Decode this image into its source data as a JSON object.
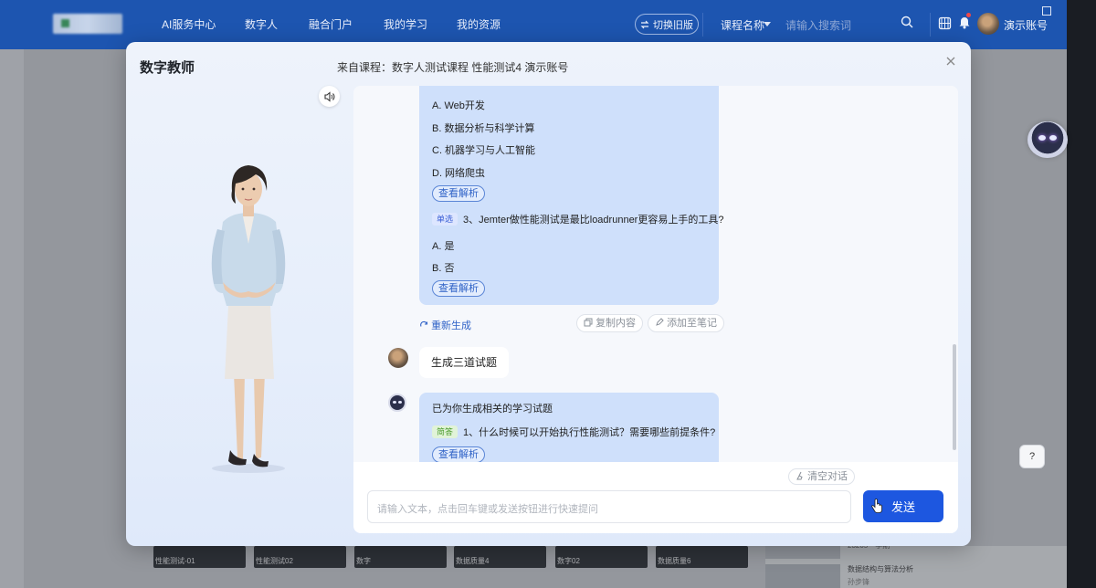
{
  "header": {
    "nav": [
      "AI服务中心",
      "数字人",
      "融合门户",
      "我的学习",
      "我的资源"
    ],
    "switch_label": "切换旧版",
    "course_select": "课程名称",
    "search_placeholder": "请输入搜索词",
    "username": "演示账号"
  },
  "background": {
    "thumbs": [
      "性能测试-01",
      "性能测试02",
      "数字",
      "数据质量4",
      "数字02",
      "数据质量6"
    ],
    "side_list": {
      "code": "23205一学期",
      "title": "数据结构与算法分析",
      "author": "孙步锋"
    }
  },
  "modal": {
    "title": "数字教师",
    "source": "来自课程：数字人测试课程 性能测试4 演示账号"
  },
  "chat": {
    "bubble1": {
      "options_q2": [
        "A. Web开发",
        "B. 数据分析与科学计算",
        "C. 机器学习与人工智能",
        "D. 网络爬虫"
      ],
      "view_analysis": "查看解析",
      "q3_tag": "单选",
      "q3_text": "3、Jemter做性能测试是最比loadrunner更容易上手的工具?",
      "options_q3": [
        "A. 是",
        "B. 否"
      ]
    },
    "actions": {
      "regen": "重新生成",
      "copy": "复制内容",
      "add_note": "添加至笔记"
    },
    "user_message": "生成三道试题",
    "bubble2": {
      "intro": "已为你生成相关的学习试题",
      "q1_tag": "简答",
      "q1_text": "1、什么时候可以开始执行性能测试？需要哪些前提条件?",
      "view_analysis": "查看解析"
    },
    "clear_label": "清空对话",
    "input_placeholder": "请输入文本，点击回车键或发送按钮进行快速提问",
    "send_label": "发送"
  },
  "float": {
    "help_label": "?"
  },
  "colors": {
    "brand": "#1d55b0",
    "send": "#1d57e0",
    "bubble": "#cfe0fb"
  }
}
